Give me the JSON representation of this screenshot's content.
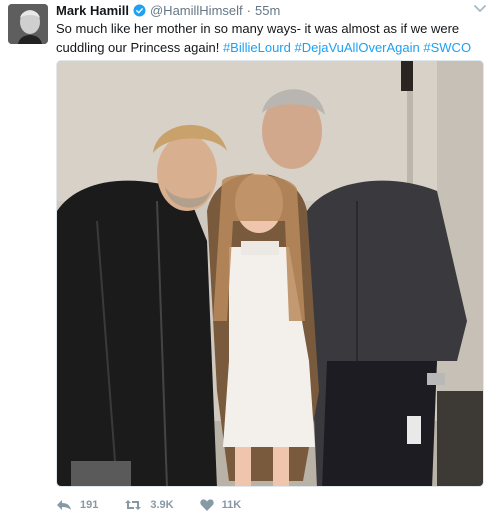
{
  "tweet": {
    "author_name": "Mark Hamill",
    "author_handle": "@HamillHimself",
    "separator": "·",
    "time": "55m",
    "text_plain": "So much like her mother in so many ways- it was almost as if we were cuddling our Princess again! ",
    "hashtags": [
      "#BillieLourd",
      "#DejaVuAllOverAgain",
      "#SWCO"
    ],
    "replies": "191",
    "retweets": "3.9K",
    "likes": "11K"
  },
  "icons": {
    "verified": "verified-badge-icon",
    "caret": "chevron-down-icon",
    "reply": "reply-icon",
    "retweet": "retweet-icon",
    "like": "heart-icon"
  },
  "colors": {
    "link": "#1da1f2",
    "muted": "#657786",
    "action": "#8899a6"
  }
}
